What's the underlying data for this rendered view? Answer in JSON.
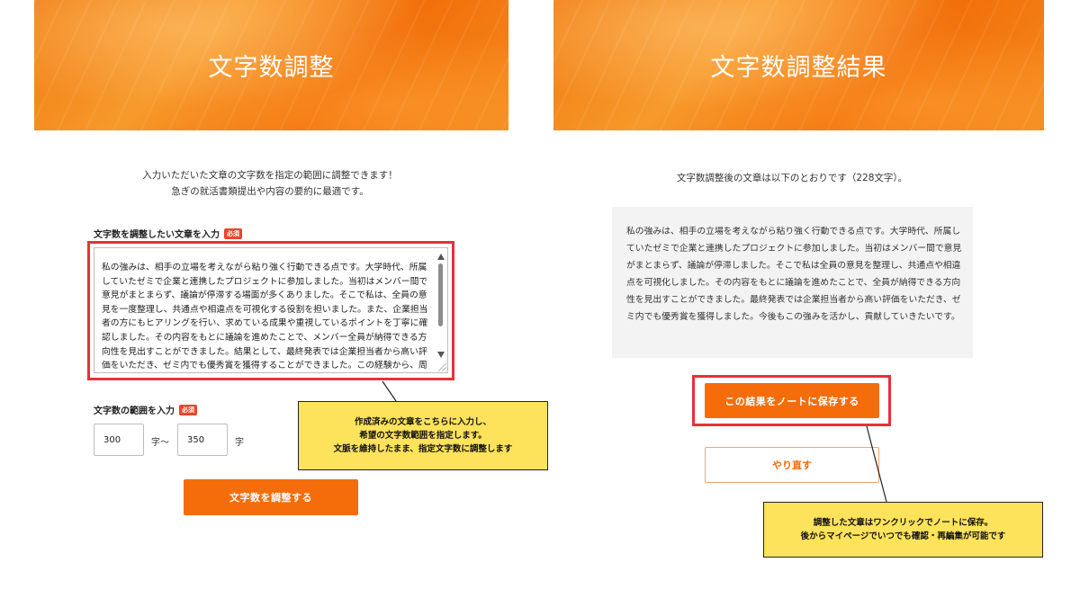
{
  "left_panel": {
    "hero_title": "文字数調整",
    "intro_line1": "入力いただいた文章の文字数を指定の範囲に調整できます！",
    "intro_line2": "急ぎの就活書類提出や内容の要約に最適です。",
    "text_field_label": "文字数を調整したい文章を入力",
    "required_badge": "必須",
    "text_value": "私の強みは、相手の立場を考えながら粘り強く行動できる点です。大学時代、所属していたゼミで企業と連携したプロジェクトに参加しました。当初はメンバー間で意見がまとまらず、議論が停滞する場面が多くありました。そこで私は、全員の意見を一度整理し、共通点や相違点を可視化する役割を担いました。また、企業担当者の方にもヒアリングを行い、求めている成果や重視しているポイントを丁寧に確認しました。その内容をもとに議論を進めたことで、メンバー全員が納得できる方向性を見出すことができました。結果として、最終発表では企業担当者から高い評価をいただき、ゼミ内でも優秀賞を獲得することができました。この経験から、周囲を巻き込みながら",
    "range_label": "文字数の範囲を入力",
    "range_required_badge": "必須",
    "range_min": "300",
    "range_min_unit": "字〜",
    "range_max": "350",
    "range_max_unit": "字",
    "submit_label": "文字数を調整する"
  },
  "right_panel": {
    "hero_title": "文字数調整結果",
    "result_intro": "文字数調整後の文章は以下のとおりです（228文字）。",
    "result_text": "私の強みは、相手の立場を考えながら粘り強く行動できる点です。大学時代、所属していたゼミで企業と連携したプロジェクトに参加しました。当初はメンバー間で意見がまとまらず、議論が停滞しました。そこで私は全員の意見を整理し、共通点や相違点を可視化しました。その内容をもとに議論を進めたことで、全員が納得できる方向性を見出すことができました。最終発表では企業担当者から高い評価をいただき、ゼミ内でも優秀賞を獲得しました。今後もこの強みを活かし、貢献していきたいです。",
    "save_label": "この結果をノートに保存する",
    "retry_label": "やり直す"
  },
  "callouts": {
    "left_line1": "作成済みの文章をこちらに入力し、",
    "left_line2": "希望の文字数範囲を指定します。",
    "left_line3": "文脈を維持したまま、指定文字数に調整します",
    "right_line1": "調整した文章はワンクリックでノートに保存。",
    "right_line2": "後からマイページでいつでも確認・再編集が可能です"
  },
  "colors": {
    "accent": "#f56d0b",
    "highlight": "#e8303a",
    "callout_bg": "#fde25b",
    "required": "#e8452c"
  }
}
